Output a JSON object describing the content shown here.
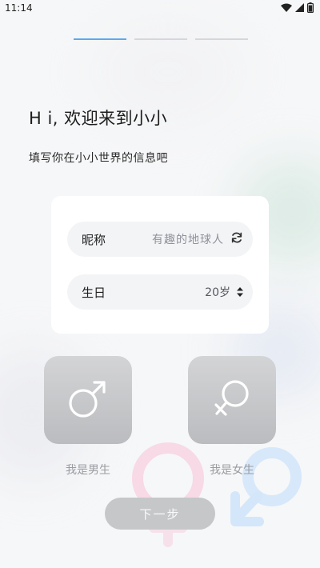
{
  "status_bar": {
    "time": "11:14"
  },
  "greeting": "H i, 欢迎来到小小",
  "subtitle": "填写你在小小世界的信息吧",
  "form": {
    "nickname_label": "昵称",
    "nickname_value": "有趣的地球人",
    "birthday_label": "生日",
    "birthday_value": "20岁"
  },
  "gender": {
    "male_label": "我是男生",
    "female_label": "我是女生"
  },
  "next_button": "下一步",
  "colors": {
    "progress_active": "#5aa9f0",
    "progress_inactive": "#d4d7db",
    "button_disabled": "#c6c7c9",
    "gender_button": "#c8c9cb"
  },
  "icons": {
    "refresh": "refresh-icon",
    "updown": "sort-updown-icon",
    "male": "male-symbol-icon",
    "female": "female-symbol-icon"
  }
}
